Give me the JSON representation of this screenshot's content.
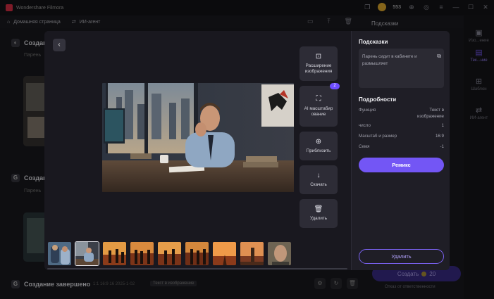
{
  "app": {
    "title": "Wondershare Filmora",
    "credits": "553"
  },
  "nav": {
    "home_label": "Домашняя страница",
    "agent_label": "ИИ-агент"
  },
  "background": {
    "row1_title": "Создани",
    "row1_sub": "Парень",
    "row2_title": "Создани",
    "row2_sub": "Парень",
    "bottom_title": "Создание завершено",
    "bottom_meta": "1:1  16:9  16  2025-1-02",
    "bottom_badge": "Текст в изображение",
    "hints_label": "Подсказки",
    "create_label": "Создать",
    "create_cost": "20",
    "service_label": "Отказ от ответственности"
  },
  "rightbar": {
    "items": [
      {
        "label": "Изо...ение",
        "icon": "image-icon"
      },
      {
        "label": "Тек...ние",
        "icon": "text-to-image-icon"
      },
      {
        "label": "Шаблон",
        "icon": "template-icon"
      },
      {
        "label": "ИИ-агент",
        "icon": "agent-icon"
      }
    ]
  },
  "modal": {
    "tools": [
      {
        "label": "Расширение изображения",
        "icon": "expand-image-icon",
        "badge": ""
      },
      {
        "label": "AI масштабирование",
        "icon": "upscale-icon",
        "badge": "2"
      },
      {
        "label": "Приблизить",
        "icon": "zoom-in-icon",
        "badge": ""
      },
      {
        "label": "Скачать",
        "icon": "download-icon",
        "badge": ""
      },
      {
        "label": "Удалить",
        "icon": "trash-icon",
        "badge": ""
      }
    ],
    "hints_title": "Подсказки",
    "prompt_text": "Парень сидит в кабинете и размышляет",
    "details_title": "Подробности",
    "details": [
      {
        "key": "Функция",
        "value": "Текст в изображение"
      },
      {
        "key": "число",
        "value": "1"
      },
      {
        "key": "Масштаб и размер",
        "value": "16:9"
      },
      {
        "key": "Семя",
        "value": "-1"
      }
    ],
    "remix_label": "Ремикс",
    "delete_label": "Удалить",
    "thumbnails": [
      {
        "name": "office-woman-man"
      },
      {
        "name": "office-man-thinking",
        "selected": true
      },
      {
        "name": "sunset-silhouettes-1"
      },
      {
        "name": "sunset-silhouettes-2"
      },
      {
        "name": "sunset-silhouettes-3"
      },
      {
        "name": "sunset-silhouettes-4"
      },
      {
        "name": "sunset-road"
      },
      {
        "name": "sunset-monument"
      },
      {
        "name": "man-portrait"
      }
    ]
  },
  "colors": {
    "accent": "#7356f5",
    "badge": "#6e4dff",
    "modal_bg": "#1f1e26"
  }
}
